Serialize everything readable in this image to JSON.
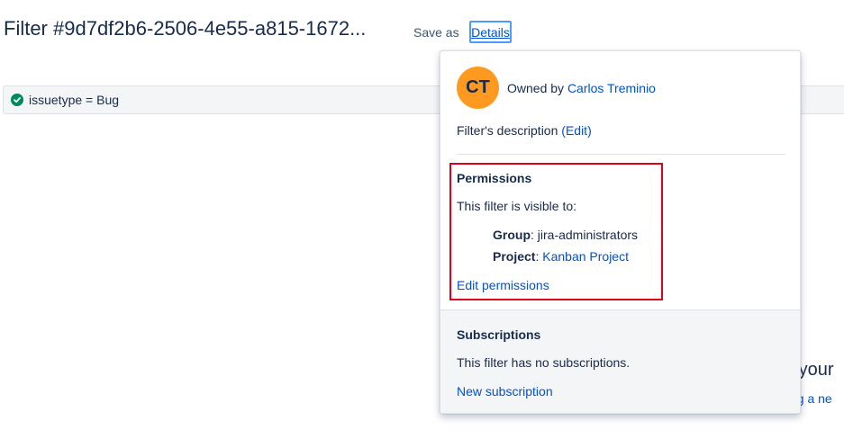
{
  "header": {
    "title": "Filter #9d7df2b6-2506-4e55-a815-1672...",
    "save_as_label": "Save as",
    "details_label": "Details"
  },
  "query": {
    "text": "issuetype = Bug",
    "status_icon": "check-circle-icon"
  },
  "background": {
    "text_1": "n your",
    "text_2": "ting a ne"
  },
  "popover": {
    "avatar_initials": "CT",
    "owned_by_label": "Owned by",
    "owner_name": "Carlos Treminio",
    "description_label": "Filter's description",
    "description_edit": "(Edit)",
    "permissions": {
      "title": "Permissions",
      "visible_to": "This filter is visible to:",
      "group_label": "Group",
      "group_value": ": jira-administrators",
      "project_label": "Project",
      "project_sep": ": ",
      "project_value": "Kanban Project",
      "edit_label": "Edit permissions"
    },
    "subscriptions": {
      "title": "Subscriptions",
      "none_text": "This filter has no subscriptions.",
      "new_label": "New subscription"
    }
  },
  "colors": {
    "avatar_bg": "#ff991f",
    "link": "#0052cc",
    "highlight": "#e0001b",
    "success": "#00875a"
  }
}
